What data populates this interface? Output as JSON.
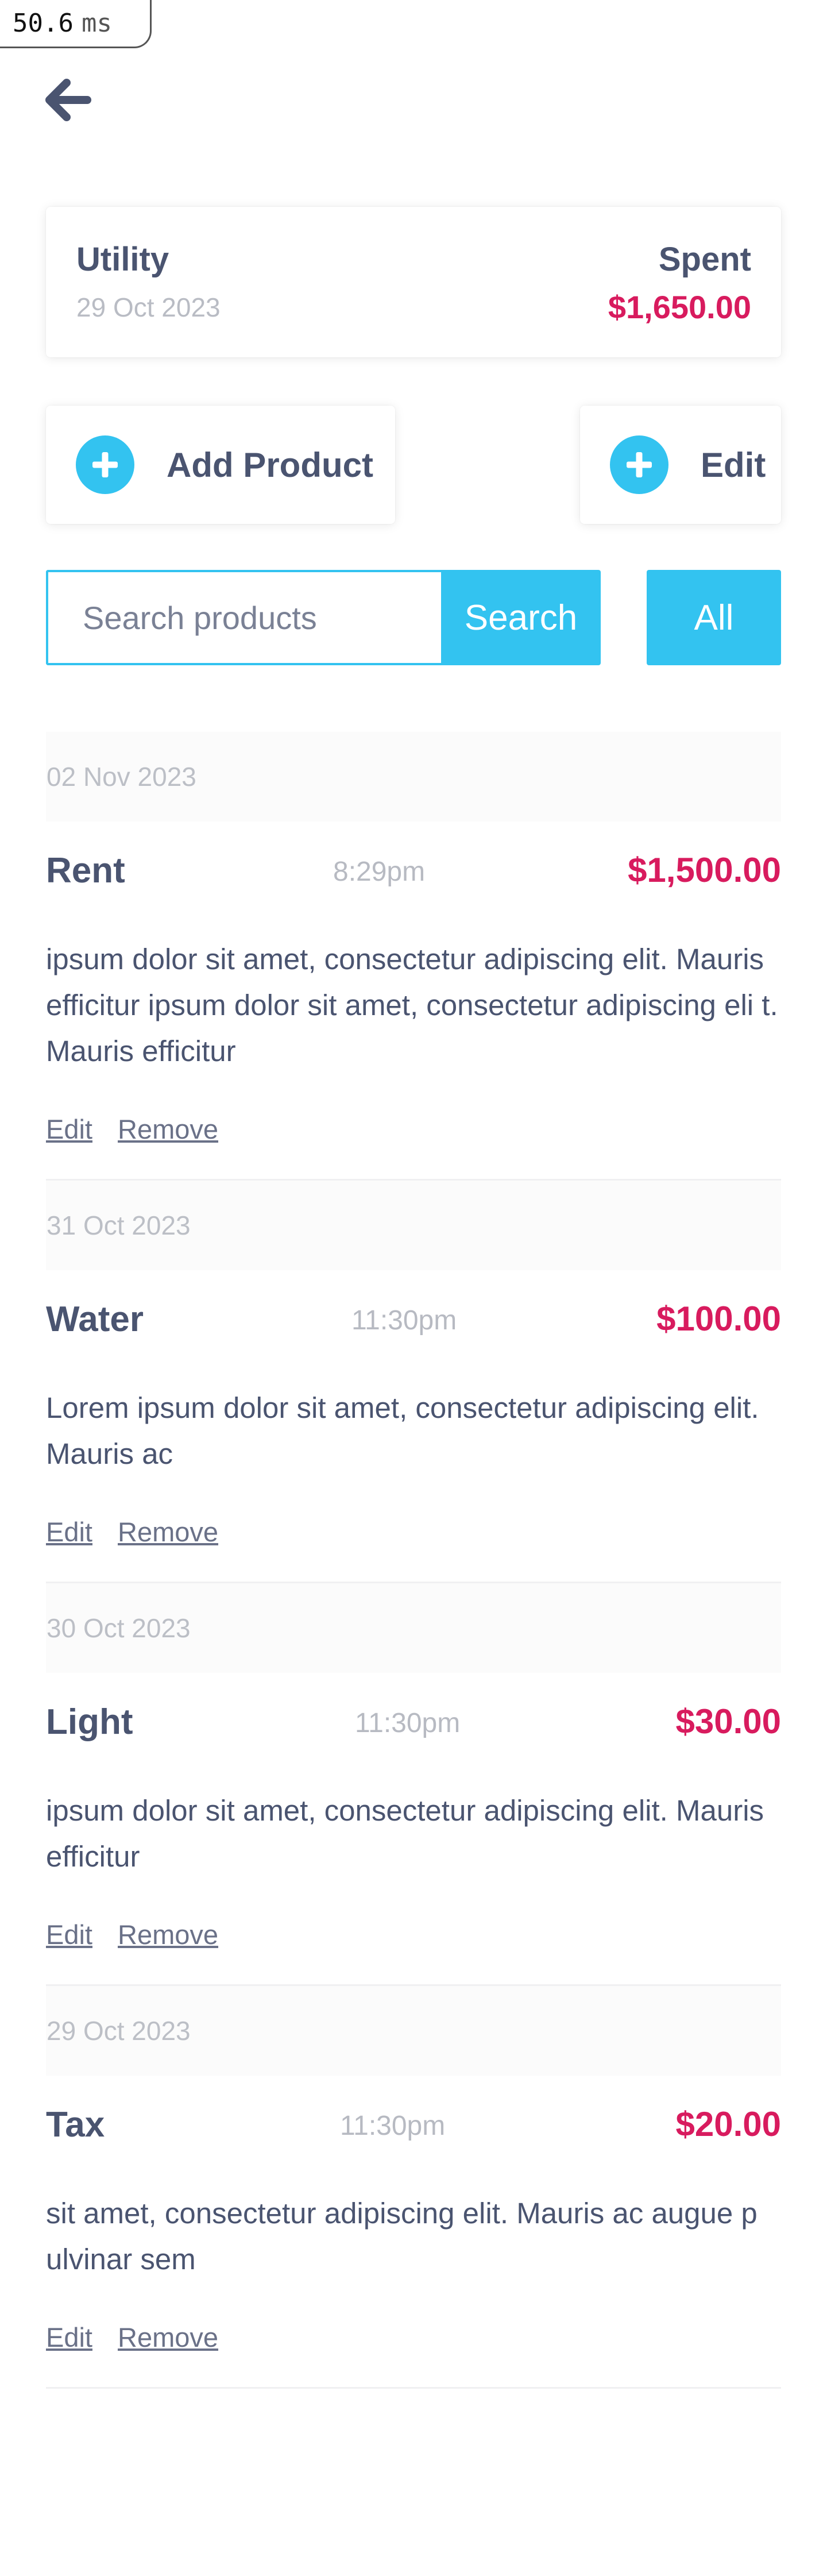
{
  "timing": {
    "value": "50.6",
    "unit": "ms"
  },
  "summary": {
    "title": "Utility",
    "date": "29 Oct 2023",
    "spent_label": "Spent",
    "spent_value": "$1,650.00"
  },
  "actions": {
    "add_label": "Add Product",
    "edit_label": "Edit"
  },
  "search": {
    "placeholder": "Search products",
    "button_label": "Search",
    "all_label": "All"
  },
  "colors": {
    "accent": "#33c3f0",
    "amount": "#d81b5e",
    "text": "#4a5470",
    "muted": "#b9bcc4"
  },
  "entries": [
    {
      "date": "02 Nov 2023",
      "name": "Rent",
      "time": "8:29pm",
      "amount": "$1,500.00",
      "description": "ipsum dolor sit amet, consectetur adipiscing elit. Mauris efficitur ipsum dolor sit amet, consectetur adipiscing eli t. Mauris efficitur",
      "edit": "Edit",
      "remove": "Remove"
    },
    {
      "date": "31 Oct 2023",
      "name": "Water",
      "time": "11:30pm",
      "amount": "$100.00",
      "description": "Lorem ipsum dolor sit amet, consectetur adipiscing elit. Mauris ac",
      "edit": "Edit",
      "remove": "Remove"
    },
    {
      "date": "30 Oct 2023",
      "name": "Light",
      "time": "11:30pm",
      "amount": "$30.00",
      "description": "ipsum dolor sit amet, consectetur adipiscing elit. Mauris efficitur",
      "edit": "Edit",
      "remove": "Remove"
    },
    {
      "date": "29 Oct 2023",
      "name": "Tax",
      "time": "11:30pm",
      "amount": "$20.00",
      "description": "sit amet, consectetur adipiscing elit. Mauris ac augue p ulvinar sem",
      "edit": "Edit",
      "remove": "Remove"
    }
  ]
}
